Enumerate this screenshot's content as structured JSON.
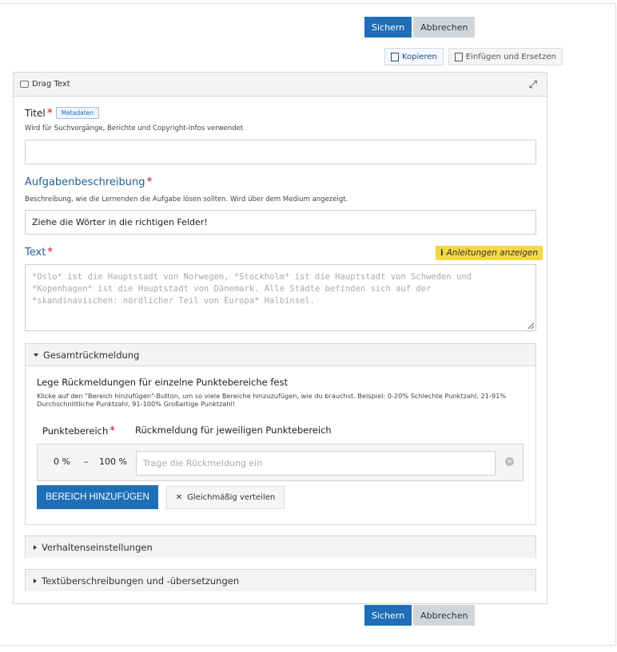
{
  "top_buttons": {
    "save": "Sichern",
    "cancel": "Abbrechen"
  },
  "copy_buttons": {
    "copy": "Kopieren",
    "paste": "Einfügen und Ersetzen"
  },
  "panel": {
    "title": "Drag Text",
    "title_field": {
      "label": "Titel",
      "metadata_tag": "Metadaten",
      "help": "Wird für Suchvorgänge, Berichte und Copyright-Infos verwendet",
      "value": ""
    },
    "task_field": {
      "label": "Aufgabenbeschreibung",
      "help": "Beschreibung, wie die Lernenden die Aufgabe lösen sollten. Wird über dem Medium angezeigt.",
      "value": "Ziehe die Wörter in die richtigen Felder!"
    },
    "text_field": {
      "label": "Text",
      "hint_button": "Anleitungen anzeigen",
      "placeholder": "*Oslo* ist die Hauptstadt von Norwegen, *Stockholm* ist die Hauptstadt von Schweden und\n*Kopenhagen* ist die Hauptstadt von Dänemark. Alle Städte befinden sich auf der\n*skandinavischen: nördlicher Teil von Europa* Halbinsel."
    },
    "overall_feedback": {
      "title": "Gesamtrückmeldung",
      "heading": "Lege Rückmeldungen für einzelne Punktebereiche fest",
      "help": "Klicke auf den \"Bereich hinzufügen\"-Button, um so viele Bereiche hinzuzufügen, wie du brauchst. Beispiel: 0-20% Schlechte Punktzahl, 21-91% Durchschnittliche Punktzahl, 91-100% Großartige Punktzahl!",
      "col_range": "Punktebereich",
      "col_feedback": "Rückmeldung für jeweiligen Punktebereich",
      "range_from": "0 %",
      "range_sep": "–",
      "range_to": "100 %",
      "feedback_placeholder": "Trage die Rückmeldung ein",
      "add_button": "BEREICH HINZUFÜGEN",
      "distribute_button": "Gleichmäßig verteilen"
    },
    "behaviour": {
      "title": "Verhaltenseinstellungen"
    },
    "translations": {
      "title": "Textüberschreibungen und -übersetzungen"
    }
  },
  "bottom_buttons": {
    "save": "Sichern",
    "cancel": "Abbrechen"
  },
  "colors": {
    "primary": "#1f6fb8",
    "required": "#c8102e",
    "hint": "#f5d645"
  }
}
